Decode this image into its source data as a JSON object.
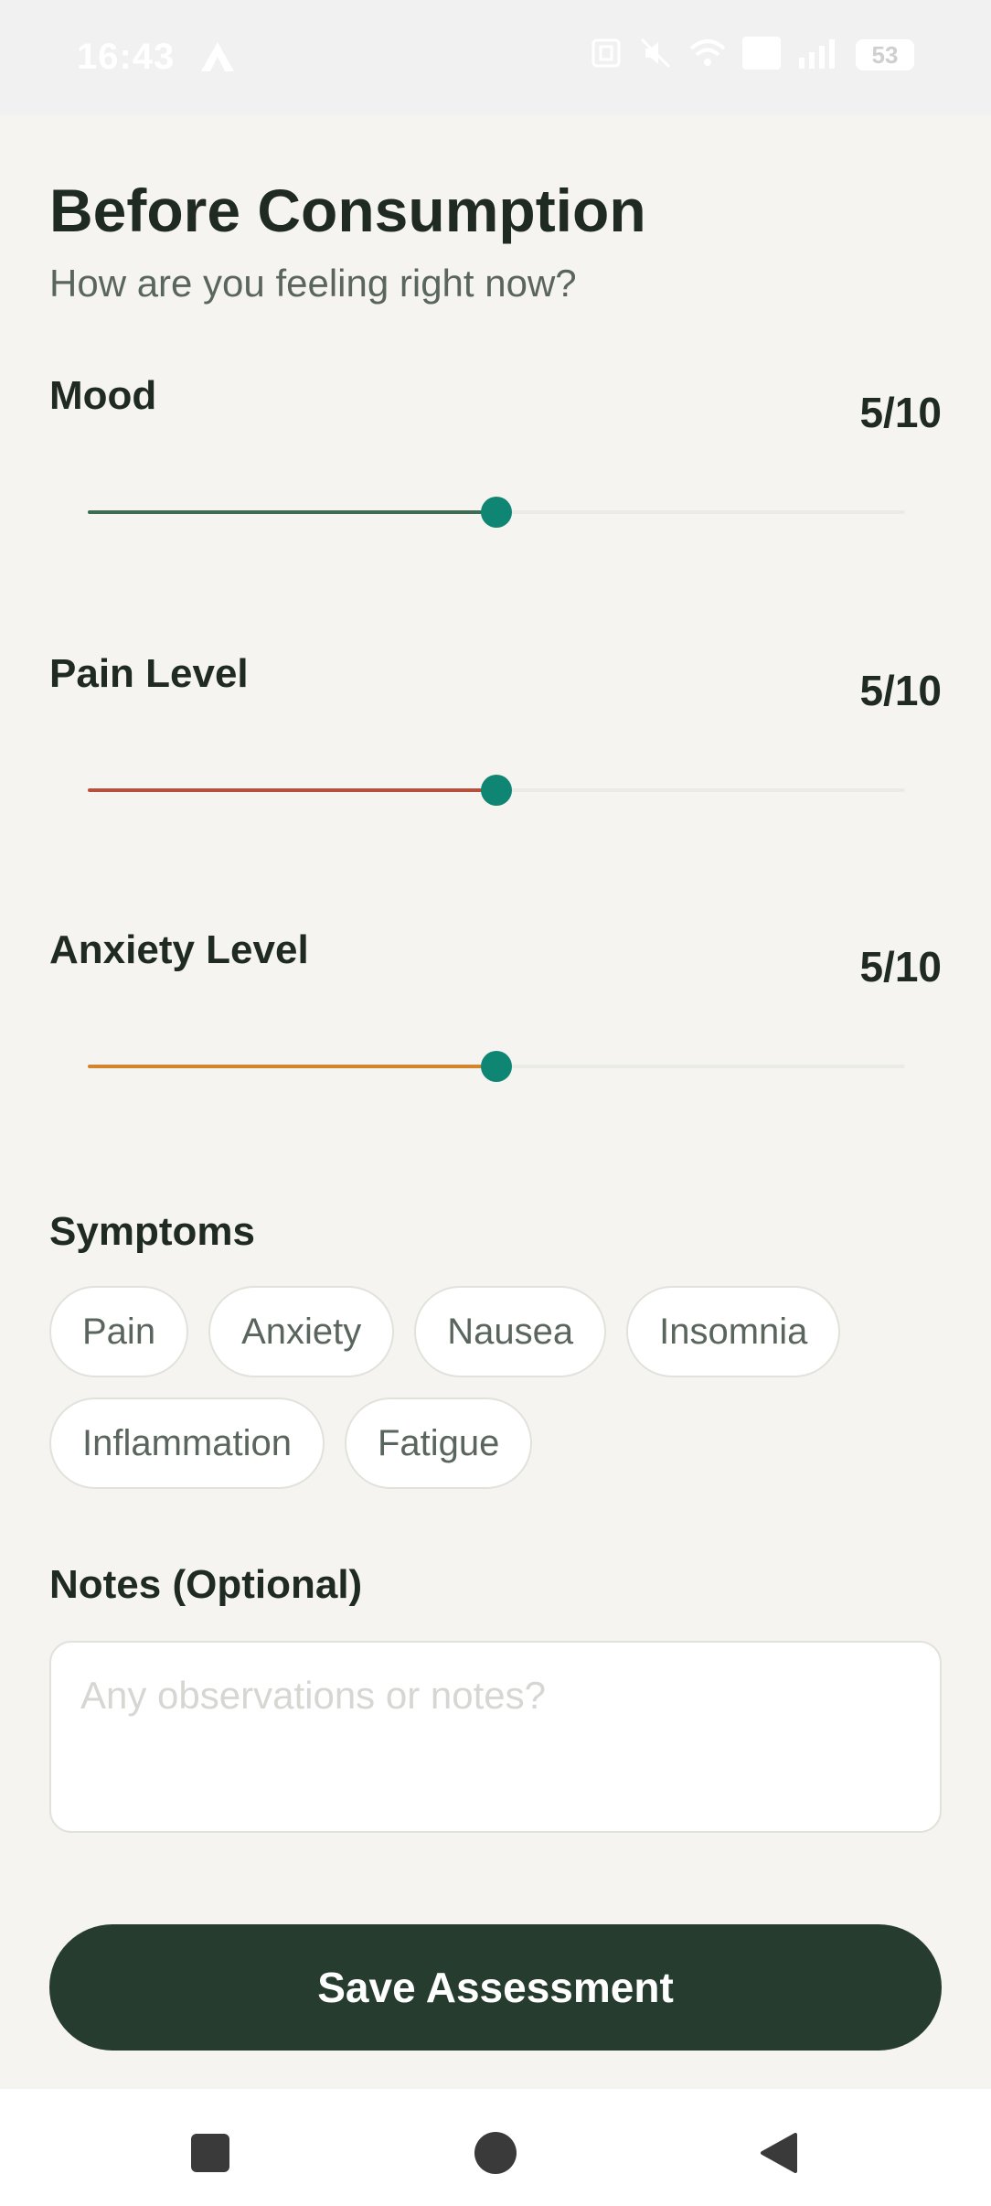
{
  "status_bar": {
    "time": "16:43",
    "battery": "53",
    "icons": [
      "nfc-icon",
      "mute-icon",
      "wifi-icon",
      "volte-icon",
      "signal-icon",
      "battery-icon"
    ]
  },
  "header": {
    "title": "Before Consumption",
    "subtitle": "How are you feeling right now?"
  },
  "sliders": [
    {
      "label": "Mood",
      "value_text": "5/10",
      "value": 5,
      "max": 10,
      "color": "#3f6b50"
    },
    {
      "label": "Pain Level",
      "value_text": "5/10",
      "value": 5,
      "max": 10,
      "color": "#b5503f"
    },
    {
      "label": "Anxiety Level",
      "value_text": "5/10",
      "value": 5,
      "max": 10,
      "color": "#d4852b"
    }
  ],
  "symptoms": {
    "title": "Symptoms",
    "options": [
      "Pain",
      "Anxiety",
      "Nausea",
      "Insomnia",
      "Inflammation",
      "Fatigue"
    ]
  },
  "notes": {
    "title": "Notes (Optional)",
    "placeholder": "Any observations or notes?",
    "value": ""
  },
  "actions": {
    "save_label": "Save Assessment"
  },
  "nav": {
    "icons": [
      "recents-icon",
      "home-icon",
      "back-icon"
    ]
  },
  "colors": {
    "thumb": "#0f8673",
    "primary_button": "#263c2e",
    "background": "#f5f4f0"
  }
}
